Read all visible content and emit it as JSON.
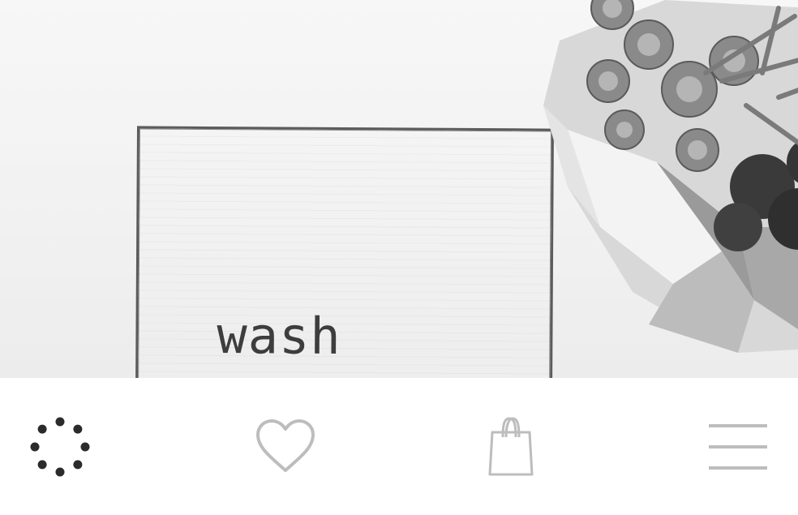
{
  "hero": {
    "sign_text": "wash"
  },
  "tabbar": {
    "tabs": [
      {
        "icon": "loading-spinner-icon"
      },
      {
        "icon": "heart-icon"
      },
      {
        "icon": "shopping-bag-icon"
      },
      {
        "icon": "hamburger-menu-icon"
      }
    ]
  },
  "colors": {
    "icon_active": "#2b2b2b",
    "icon_inactive": "#bdbdbd",
    "background": "#ffffff"
  }
}
